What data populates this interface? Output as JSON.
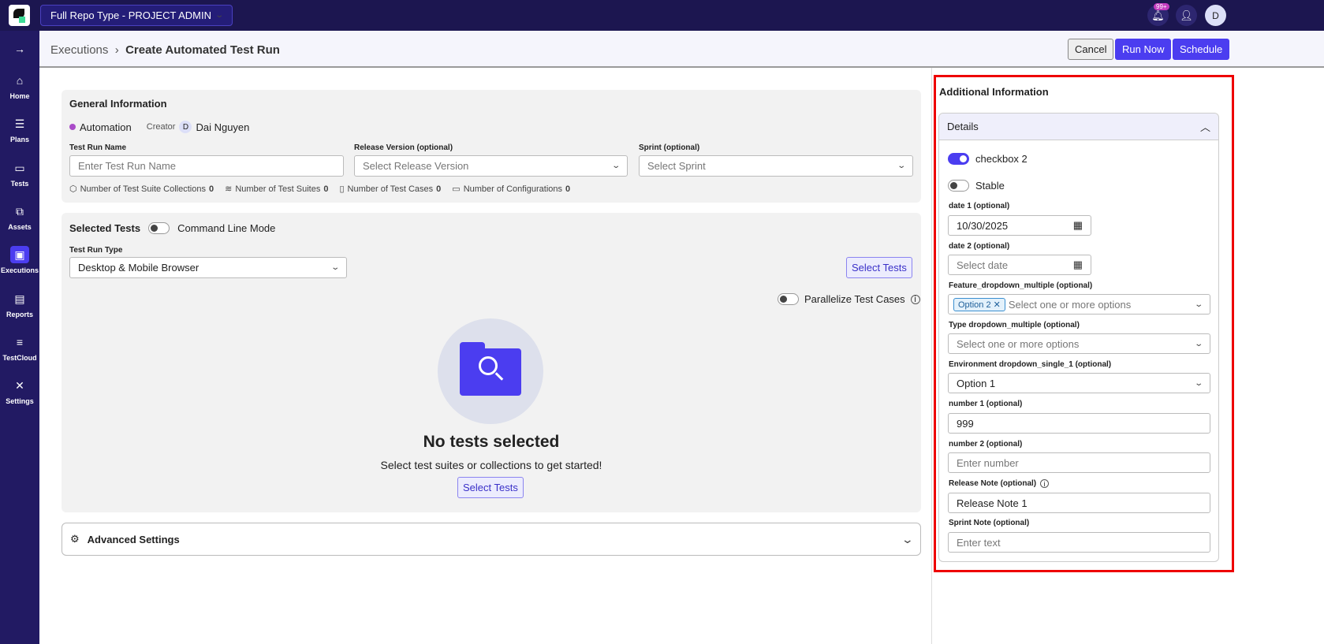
{
  "topbar": {
    "project": "Full Repo Type - PROJECT ADMIN",
    "notif_badge": "99+",
    "user_initial": "D"
  },
  "sidebar": {
    "items": [
      {
        "label": "Home",
        "icon": "⌂"
      },
      {
        "label": "Plans",
        "icon": "☰"
      },
      {
        "label": "Tests",
        "icon": "▭"
      },
      {
        "label": "Assets",
        "icon": "⧉"
      },
      {
        "label": "Executions",
        "icon": "▣"
      },
      {
        "label": "Reports",
        "icon": "▤"
      },
      {
        "label": "TestCloud",
        "icon": "≡"
      },
      {
        "label": "Settings",
        "icon": "✕"
      }
    ],
    "expand_icon": "→"
  },
  "header": {
    "breadcrumb_parent": "Executions",
    "breadcrumb_current": "Create Automated Test Run",
    "cancel": "Cancel",
    "run_now": "Run Now",
    "schedule": "Schedule"
  },
  "general": {
    "title": "General Information",
    "type": "Automation",
    "creator_label": "Creator",
    "creator_initial": "D",
    "creator_name": "Dai Nguyen",
    "test_run_name_label": "Test Run Name",
    "test_run_name_placeholder": "Enter Test Run Name",
    "release_label": "Release Version (optional)",
    "release_placeholder": "Select Release Version",
    "sprint_label": "Sprint (optional)",
    "sprint_placeholder": "Select Sprint",
    "stats": [
      {
        "label": "Number of Test Suite Collections",
        "value": "0"
      },
      {
        "label": "Number of Test Suites",
        "value": "0"
      },
      {
        "label": "Number of Test Cases",
        "value": "0"
      },
      {
        "label": "Number of Configurations",
        "value": "0"
      }
    ]
  },
  "selected": {
    "title": "Selected Tests",
    "cli_label": "Command Line Mode",
    "run_type_label": "Test Run Type",
    "run_type_value": "Desktop & Mobile Browser",
    "select_tests": "Select Tests",
    "parallel_label": "Parallelize Test Cases",
    "empty_title": "No tests selected",
    "empty_sub": "Select test suites or collections to get started!"
  },
  "advanced": {
    "title": "Advanced Settings"
  },
  "additional": {
    "title": "Additional Information",
    "section": "Details",
    "checkbox2": "checkbox 2",
    "checkbox2_on": true,
    "stable": "Stable",
    "stable_on": false,
    "date1_label": "date 1 (optional)",
    "date1_value": "10/30/2025",
    "date2_label": "date 2 (optional)",
    "date2_placeholder": "Select date",
    "feature_label": "Feature_dropdown_multiple (optional)",
    "feature_tag": "Option 2",
    "multi_placeholder": "Select one or more options",
    "type_label": "Type dropdown_multiple (optional)",
    "env_label": "Environment dropdown_single_1 (optional)",
    "env_value": "Option 1",
    "number1_label": "number 1 (optional)",
    "number1_value": "999",
    "number2_label": "number 2 (optional)",
    "number_placeholder": "Enter number",
    "release_note_label": "Release Note (optional)",
    "release_note_value": "Release Note 1",
    "sprint_note_label": "Sprint Note (optional)",
    "text_placeholder": "Enter text"
  }
}
